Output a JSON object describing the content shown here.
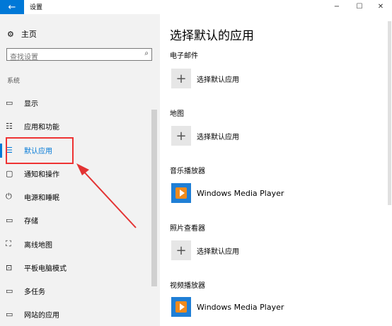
{
  "window": {
    "title": "设置",
    "back_icon": "←",
    "minimize_icon": "−",
    "maximize_icon": "☐",
    "close_icon": "✕"
  },
  "nav": {
    "home_label": "主页",
    "home_icon": "⚙",
    "search_placeholder": "查找设置",
    "search_icon": "⌕",
    "section_label": "系统",
    "items": [
      {
        "icon": "▭",
        "label": "显示"
      },
      {
        "icon": "☷",
        "label": "应用和功能"
      },
      {
        "icon": "☰",
        "label": "默认应用"
      },
      {
        "icon": "▢",
        "label": "通知和操作"
      },
      {
        "icon": "⏻",
        "label": "电源和睡眠"
      },
      {
        "icon": "▭",
        "label": "存储"
      },
      {
        "icon": "⛶",
        "label": "离线地图"
      },
      {
        "icon": "⊡",
        "label": "平板电脑模式"
      },
      {
        "icon": "▭",
        "label": "多任务"
      },
      {
        "icon": "▭",
        "label": "网站的应用"
      }
    ]
  },
  "content": {
    "heading": "选择默认的应用",
    "categories": [
      {
        "label": "电子邮件",
        "app": "选择默认应用",
        "icon": "plus"
      },
      {
        "label": "地图",
        "app": "选择默认应用",
        "icon": "plus"
      },
      {
        "label": "音乐播放器",
        "app": "Windows Media Player",
        "icon": "wmp"
      },
      {
        "label": "照片查看器",
        "app": "选择默认应用",
        "icon": "plus"
      },
      {
        "label": "视频播放器",
        "app": "Windows Media Player",
        "icon": "wmp"
      }
    ]
  },
  "colors": {
    "accent": "#0078d7",
    "annotation": "#e33333"
  }
}
